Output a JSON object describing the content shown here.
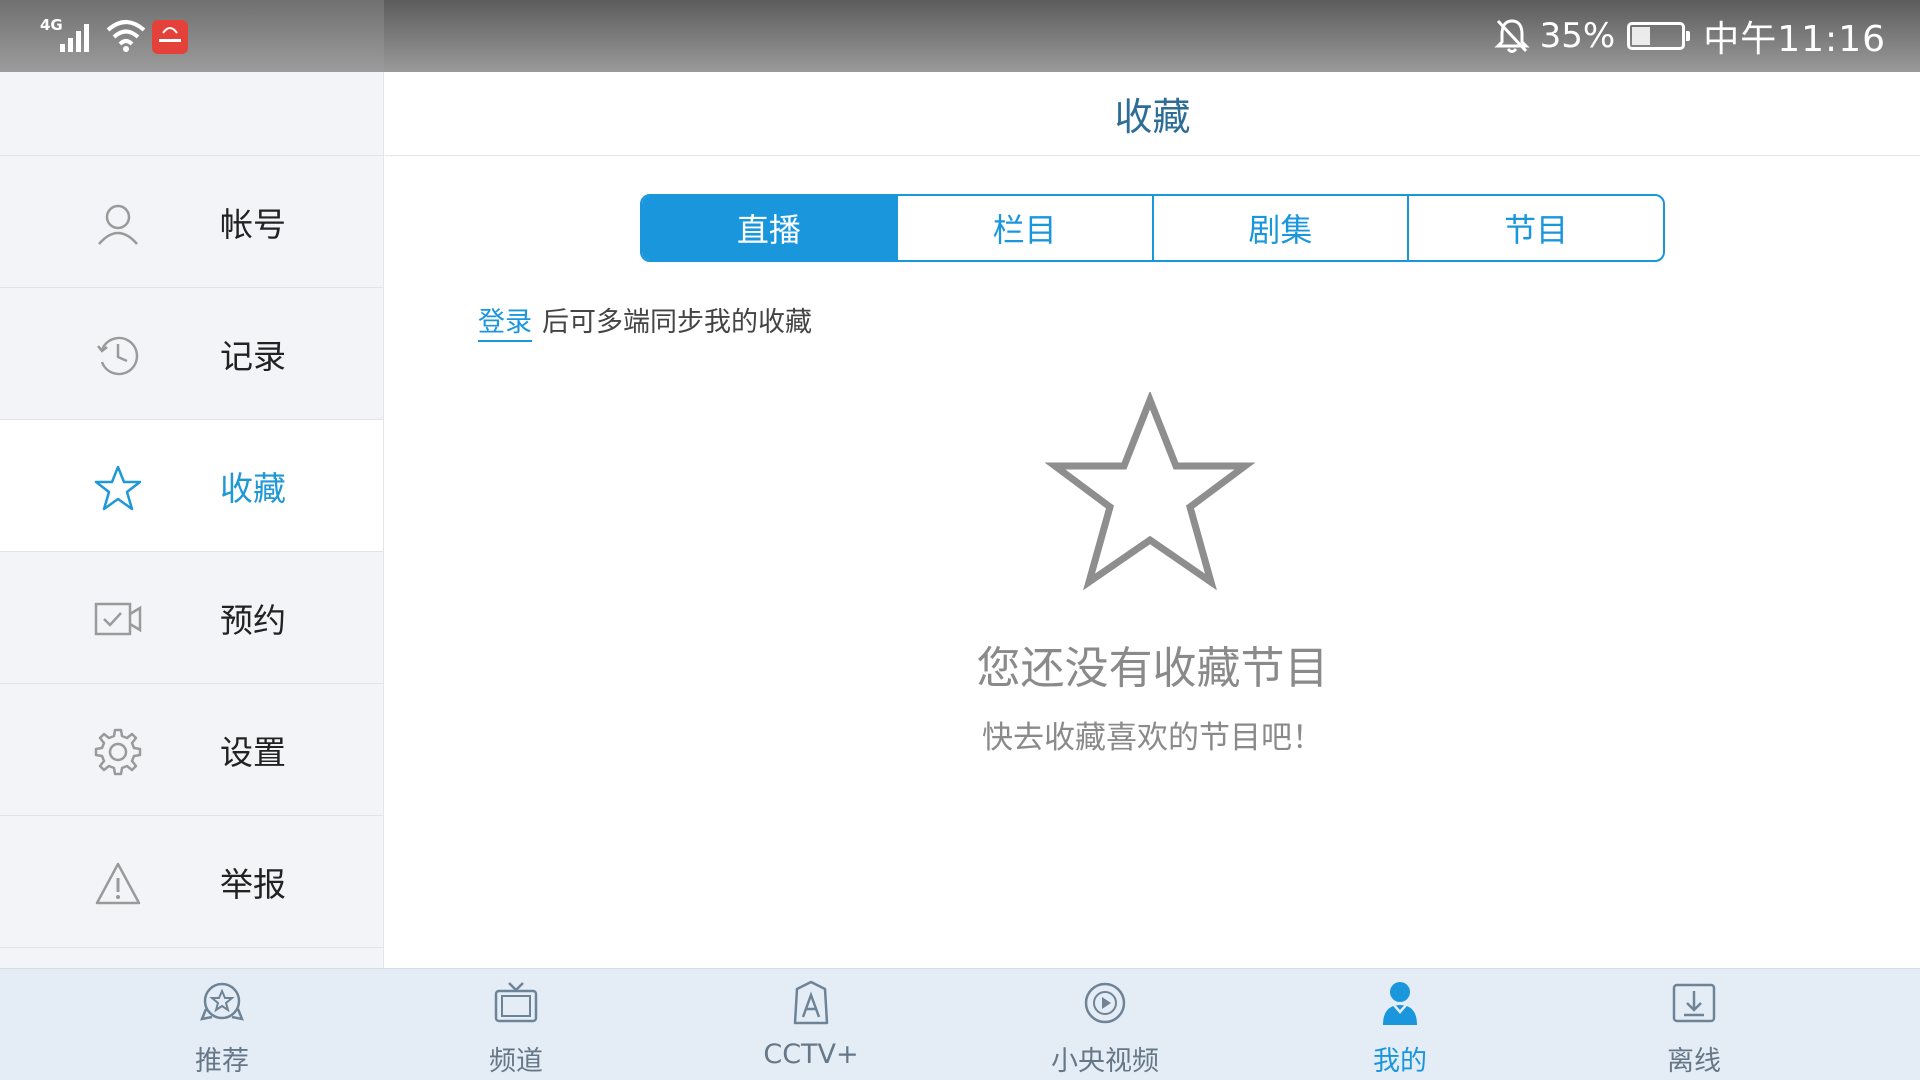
{
  "status_bar": {
    "network": "4G",
    "battery_percent": "35%",
    "battery_level": 0.35,
    "time": "中午11:16"
  },
  "sidebar": {
    "items": [
      {
        "label": "帐号",
        "icon": "user-icon"
      },
      {
        "label": "记录",
        "icon": "history-icon"
      },
      {
        "label": "收藏",
        "icon": "star-icon",
        "active": true
      },
      {
        "label": "预约",
        "icon": "video-reserve-icon"
      },
      {
        "label": "设置",
        "icon": "gear-icon"
      },
      {
        "label": "举报",
        "icon": "warning-icon"
      }
    ]
  },
  "main": {
    "title": "收藏",
    "tabs": [
      {
        "label": "直播",
        "active": true
      },
      {
        "label": "栏目"
      },
      {
        "label": "剧集"
      },
      {
        "label": "节目"
      }
    ],
    "login_link": "登录",
    "login_hint": "后可多端同步我的收藏",
    "empty_title": "您还没有收藏节目",
    "empty_subtitle": "快去收藏喜欢的节目吧！"
  },
  "bottom_nav": {
    "items": [
      {
        "label": "推荐",
        "icon": "recommend-badge-icon"
      },
      {
        "label": "频道",
        "icon": "tv-icon"
      },
      {
        "label": "CCTV+",
        "icon": "cctv-plus-icon"
      },
      {
        "label": "小央视频",
        "icon": "play-circle-icon"
      },
      {
        "label": "我的",
        "icon": "person-icon",
        "active": true
      },
      {
        "label": "离线",
        "icon": "download-icon"
      }
    ]
  },
  "colors": {
    "accent": "#1a97dc",
    "sidebar_bg": "#f3f4f7",
    "nav_bg": "#e4edf5",
    "muted_text": "#8a8a8a"
  }
}
